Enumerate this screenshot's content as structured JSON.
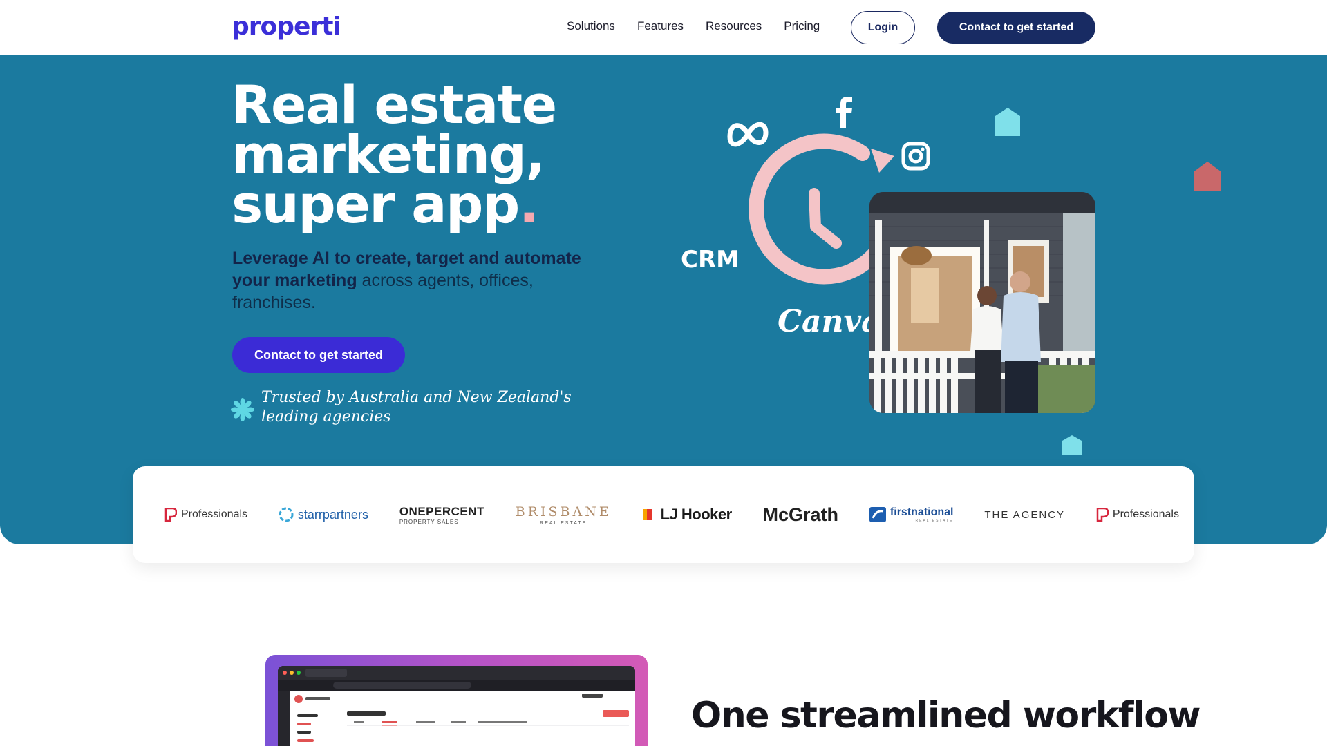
{
  "nav": {
    "logo": "properti",
    "links": [
      "Solutions",
      "Features",
      "Resources",
      "Pricing"
    ],
    "login": "Login",
    "contact": "Contact to get started"
  },
  "hero": {
    "title_line1": "Real estate",
    "title_line2": "marketing,",
    "title_line3": "super app",
    "title_dot": ".",
    "subtitle_bold": "Leverage AI to create, target and automate your marketing",
    "subtitle_rest": " across agents, offices, franchises.",
    "cta": "Contact to get started",
    "trusted": "Trusted by Australia and New Zealand's leading agencies",
    "graphic_labels": {
      "crm": "CRM",
      "canva": "Canva"
    }
  },
  "brands": [
    "Professionals",
    "starrpartners",
    "ONEPERCENT",
    "BRISBANE",
    "LJ Hooker",
    "McGrath",
    "firstnational",
    "THE AGENCY",
    "Professionals"
  ],
  "brand_sublabels": {
    "onepercent": "PROPERTY SALES",
    "brisbane": "REAL ESTATE",
    "firstnational": "REAL ESTATE"
  },
  "section2": {
    "title": "One streamlined workflow"
  },
  "colors": {
    "brand": "#3b2fd8",
    "hero_bg": "#1b7a9f",
    "navy": "#182b63",
    "cta": "#3b2bd6",
    "pink": "#f4a9b0",
    "cyan": "#7fe0ea",
    "red": "#c9686a"
  }
}
